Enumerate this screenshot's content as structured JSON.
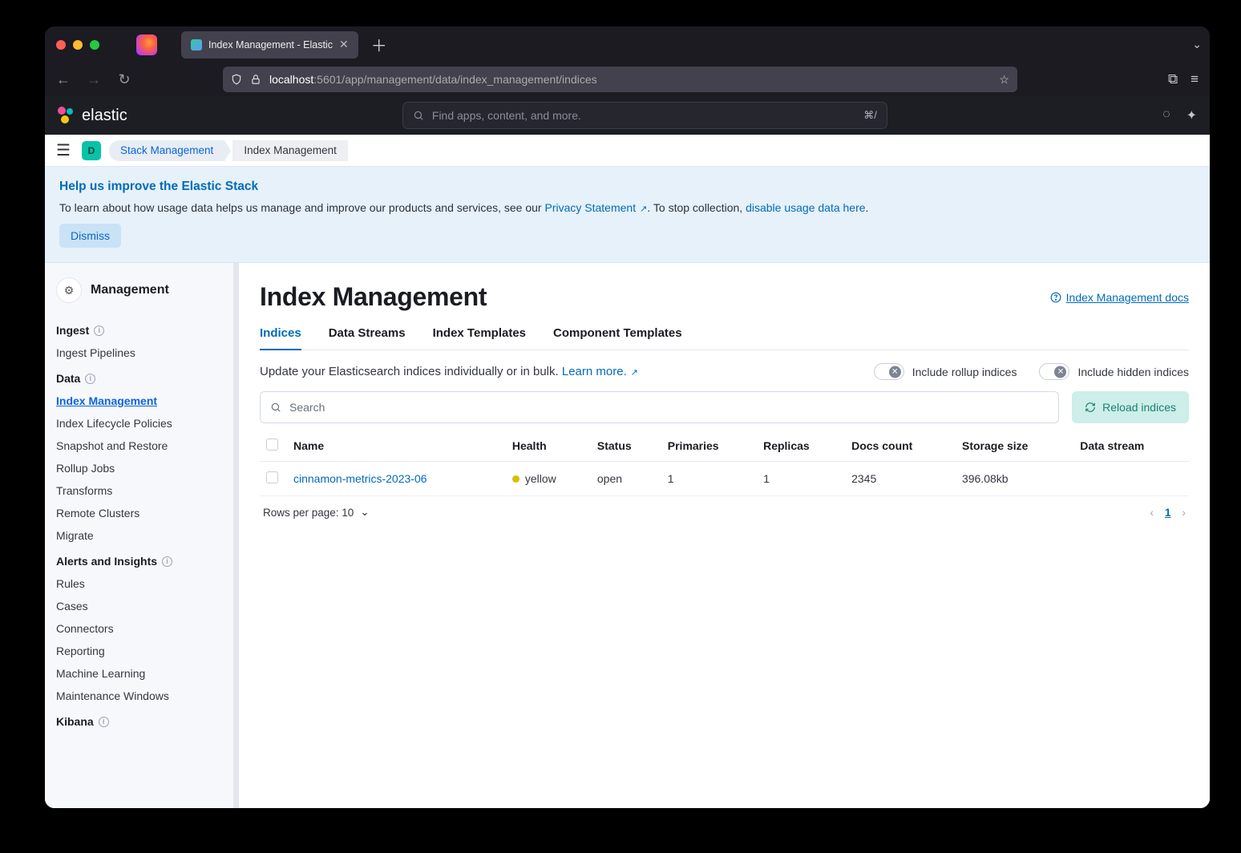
{
  "browser": {
    "tab_title": "Index Management - Elastic",
    "url_host": "localhost",
    "url_port_path": ":5601/app/management/data/index_management/indices"
  },
  "kibana": {
    "brand": "elastic",
    "search_placeholder": "Find apps, content, and more.",
    "search_shortcut": "⌘/",
    "deployment_badge": "D",
    "breadcrumbs": [
      "Stack Management",
      "Index Management"
    ]
  },
  "banner": {
    "title": "Help us improve the Elastic Stack",
    "lead": "To learn about how usage data helps us manage and improve our products and services, see our ",
    "privacy_link": "Privacy Statement",
    "mid": ". To stop collection, ",
    "disable_link": "disable usage data here",
    "tail": ".",
    "dismiss": "Dismiss"
  },
  "sidebar": {
    "title": "Management",
    "sections": [
      {
        "heading": "Ingest",
        "info": true,
        "items": [
          "Ingest Pipelines"
        ]
      },
      {
        "heading": "Data",
        "info": true,
        "items": [
          "Index Management",
          "Index Lifecycle Policies",
          "Snapshot and Restore",
          "Rollup Jobs",
          "Transforms",
          "Remote Clusters",
          "Migrate"
        ],
        "active_index": 0
      },
      {
        "heading": "Alerts and Insights",
        "info": true,
        "items": [
          "Rules",
          "Cases",
          "Connectors",
          "Reporting",
          "Machine Learning",
          "Maintenance Windows"
        ]
      },
      {
        "heading": "Kibana",
        "info": true,
        "items": []
      }
    ]
  },
  "page": {
    "title": "Index Management",
    "docs_link": "Index Management docs",
    "tabs": [
      "Indices",
      "Data Streams",
      "Index Templates",
      "Component Templates"
    ],
    "active_tab": 0,
    "description": "Update your Elasticsearch indices individually or in bulk. ",
    "learn_more": "Learn more.",
    "toggles": {
      "rollup": "Include rollup indices",
      "hidden": "Include hidden indices"
    },
    "search_placeholder": "Search",
    "reload": "Reload indices",
    "columns": [
      "Name",
      "Health",
      "Status",
      "Primaries",
      "Replicas",
      "Docs count",
      "Storage size",
      "Data stream"
    ],
    "rows": [
      {
        "name": "cinnamon-metrics-2023-06",
        "health": "yellow",
        "status": "open",
        "primaries": "1",
        "replicas": "1",
        "docs": "2345",
        "storage": "396.08kb",
        "stream": ""
      }
    ],
    "rows_per_page_label": "Rows per page: 10",
    "current_page": "1"
  }
}
